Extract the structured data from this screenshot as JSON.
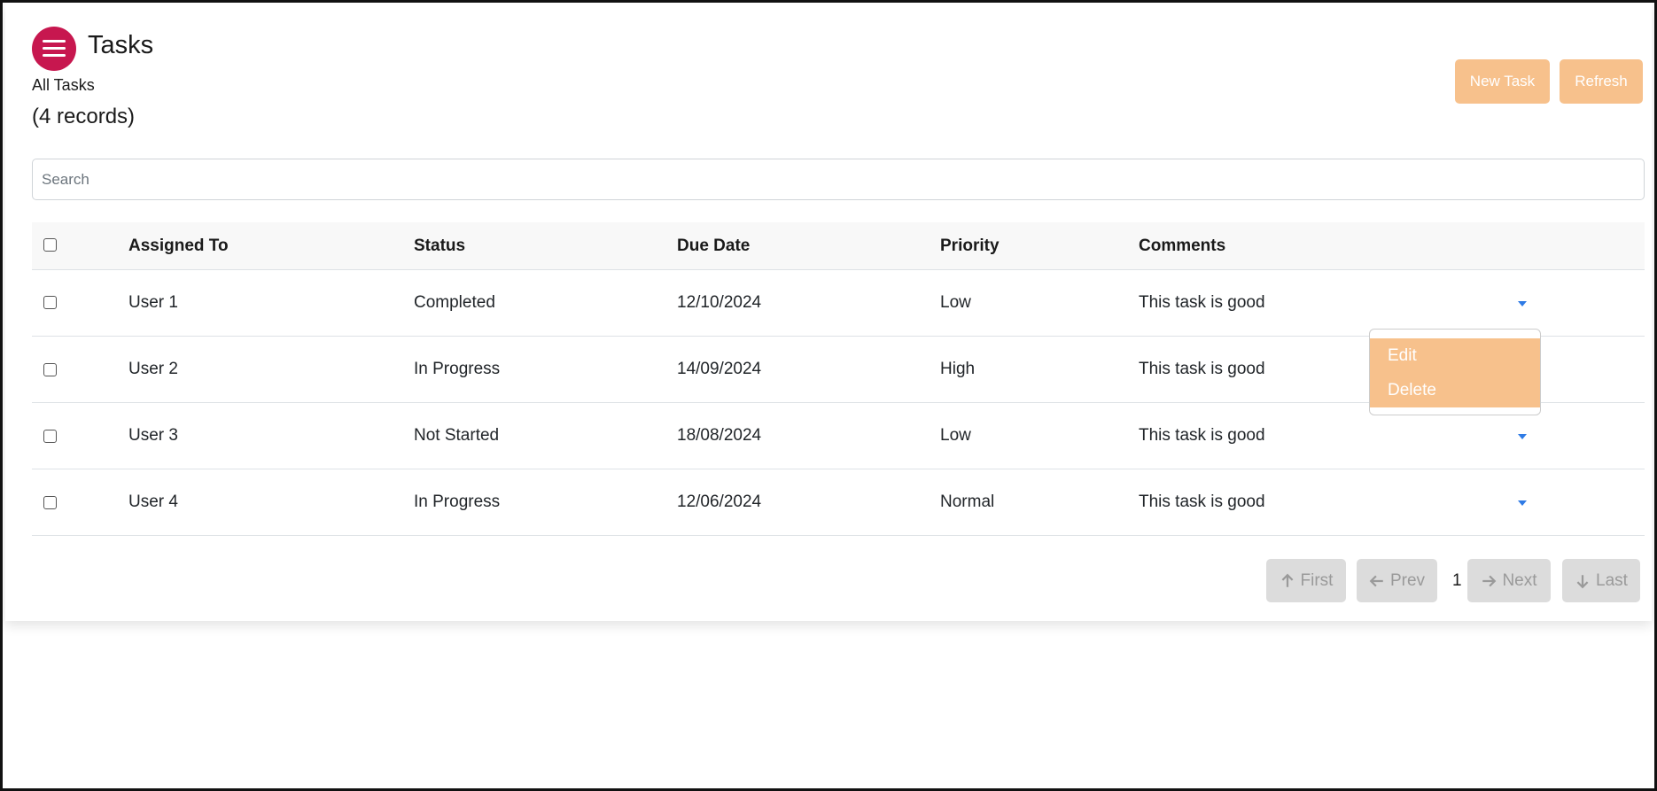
{
  "header": {
    "title": "Tasks",
    "subtitle": "All Tasks",
    "record_count": "(4 records)",
    "menu_icon": "hamburger-menu-icon",
    "accent_color": "#c7174f"
  },
  "toolbar": {
    "new_task_label": "New Task",
    "refresh_label": "Refresh",
    "button_color": "#f7c18c"
  },
  "search": {
    "placeholder": "Search",
    "value": ""
  },
  "table": {
    "columns": [
      "Assigned To",
      "Status",
      "Due Date",
      "Priority",
      "Comments"
    ],
    "rows": [
      {
        "assigned_to": "User 1",
        "status": "Completed",
        "due_date": "12/10/2024",
        "priority": "Low",
        "comments": "This task is good"
      },
      {
        "assigned_to": "User 2",
        "status": "In Progress",
        "due_date": "14/09/2024",
        "priority": "High",
        "comments": "This task is good"
      },
      {
        "assigned_to": "User 3",
        "status": "Not Started",
        "due_date": "18/08/2024",
        "priority": "Low",
        "comments": "This task is good"
      },
      {
        "assigned_to": "User 4",
        "status": "In Progress",
        "due_date": "12/06/2024",
        "priority": "Normal",
        "comments": "This task is good"
      }
    ]
  },
  "row_menu": {
    "items": [
      "Edit",
      "Delete"
    ]
  },
  "pagination": {
    "first_label": "First",
    "prev_label": "Prev",
    "current_page": "1",
    "next_label": "Next",
    "last_label": "Last"
  }
}
